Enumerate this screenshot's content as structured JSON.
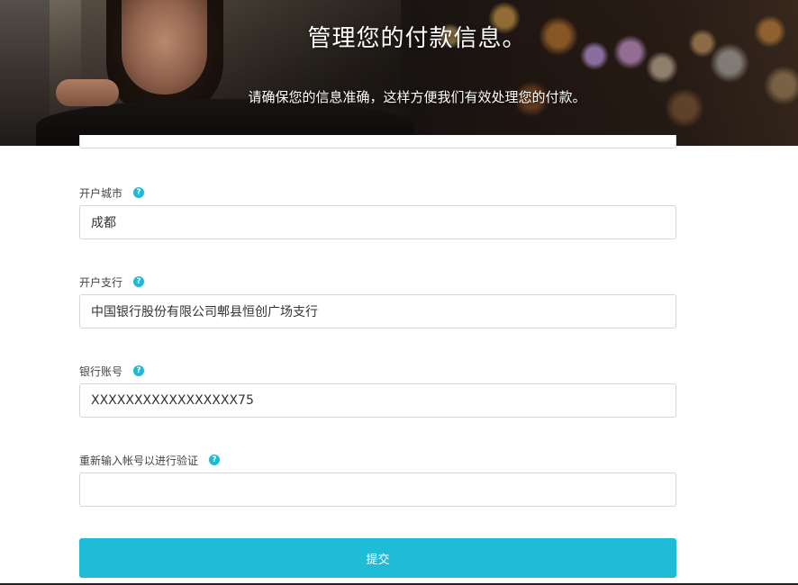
{
  "hero": {
    "title": "管理您的付款信息。",
    "subtitle": "请确保您的信息准确，这样方便我们有效处理您的付款。"
  },
  "form": {
    "fields": [
      {
        "label": "开户城市",
        "value": "成都",
        "help_icon": "question-circle-icon"
      },
      {
        "label": "开户支行",
        "value": "中国银行股份有限公司郫县恒创广场支行",
        "help_icon": "question-circle-icon"
      },
      {
        "label": "银行账号",
        "value": "XXXXXXXXXXXXXXXXX75",
        "help_icon": "question-circle-icon"
      },
      {
        "label": "重新输入帐号以进行验证",
        "value": "",
        "help_icon": "question-circle-icon"
      }
    ],
    "help_glyph": "?",
    "submit_label": "提交"
  },
  "colors": {
    "accent": "#1fbcd8",
    "help_icon": "#1fb8d6",
    "input_border": "#d6d6d6"
  }
}
